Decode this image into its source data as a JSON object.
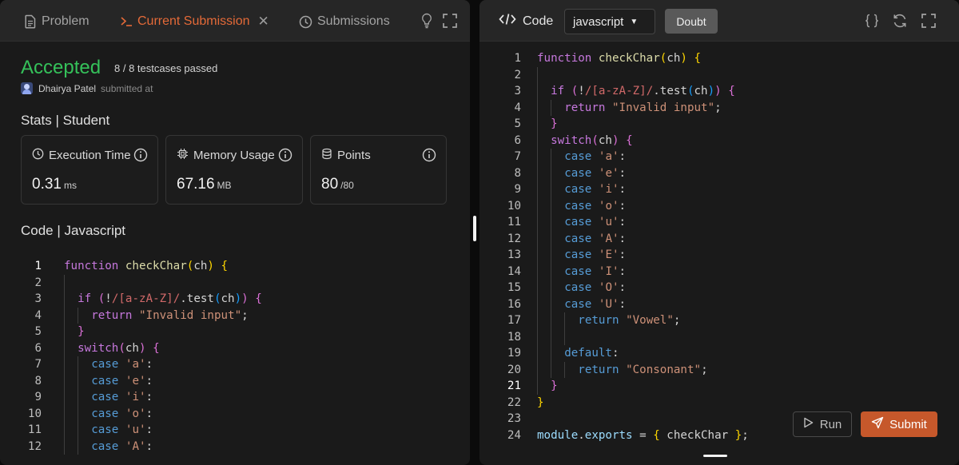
{
  "left_panel": {
    "tabs": [
      {
        "label": "Problem",
        "icon": "document-icon"
      },
      {
        "label": "Current Submission",
        "icon": "terminal-icon",
        "active": true
      },
      {
        "label": "Submissions",
        "icon": "clock-icon"
      }
    ],
    "status": "Accepted",
    "testcases": "8 / 8 testcases passed",
    "user_name": "Dhairya Patel",
    "submitted_label": "submitted at",
    "stats_title": "Stats | Student",
    "stats": [
      {
        "label": "Execution Time",
        "value": "0.31",
        "unit": "ms",
        "icon": "clock-icon"
      },
      {
        "label": "Memory Usage",
        "value": "67.16",
        "unit": "MB",
        "icon": "chip-icon"
      },
      {
        "label": "Points",
        "value": "80",
        "unit": "/80",
        "icon": "database-icon"
      }
    ],
    "code_title": "Code | Javascript",
    "code_line_count": 12
  },
  "right_panel": {
    "code_label": "Code",
    "language": "javascript",
    "doubt_label": "Doubt",
    "run_label": "Run",
    "submit_label": "Submit",
    "active_line": 21
  },
  "colors": {
    "accent": "#e46a38",
    "accepted": "#35c15a",
    "submit_bg": "#c6582b",
    "panel_bg": "#1a1a1a",
    "header_bg": "#262626"
  },
  "code_lines": [
    {
      "n": 1,
      "indent": 0,
      "tokens": [
        [
          "kw",
          "function"
        ],
        [
          "txt",
          " "
        ],
        [
          "fn",
          "checkChar"
        ],
        [
          "br1",
          "("
        ],
        [
          "txt",
          "ch"
        ],
        [
          "br1",
          ")"
        ],
        [
          "txt",
          " "
        ],
        [
          "br1",
          "{"
        ]
      ]
    },
    {
      "n": 2,
      "indent": 1,
      "tokens": []
    },
    {
      "n": 3,
      "indent": 1,
      "tokens": [
        [
          "kw",
          "if"
        ],
        [
          "txt",
          " "
        ],
        [
          "br2",
          "("
        ],
        [
          "txt",
          "!"
        ],
        [
          "re",
          "/[a-zA-Z]/"
        ],
        [
          "txt",
          ".test"
        ],
        [
          "br3",
          "("
        ],
        [
          "txt",
          "ch"
        ],
        [
          "br3",
          ")"
        ],
        [
          "br2",
          ")"
        ],
        [
          "txt",
          " "
        ],
        [
          "br2",
          "{"
        ]
      ]
    },
    {
      "n": 4,
      "indent": 2,
      "tokens": [
        [
          "kw",
          "return"
        ],
        [
          "txt",
          " "
        ],
        [
          "str",
          "\"Invalid input\""
        ],
        [
          "txt",
          ";"
        ]
      ]
    },
    {
      "n": 5,
      "indent": 1,
      "tokens": [
        [
          "br2",
          "}"
        ]
      ]
    },
    {
      "n": 6,
      "indent": 1,
      "tokens": [
        [
          "kw",
          "switch"
        ],
        [
          "br2",
          "("
        ],
        [
          "txt",
          "ch"
        ],
        [
          "br2",
          ")"
        ],
        [
          "txt",
          " "
        ],
        [
          "br2",
          "{"
        ]
      ]
    },
    {
      "n": 7,
      "indent": 2,
      "tokens": [
        [
          "blue",
          "case"
        ],
        [
          "txt",
          " "
        ],
        [
          "str",
          "'a'"
        ],
        [
          "txt",
          ":"
        ]
      ]
    },
    {
      "n": 8,
      "indent": 2,
      "tokens": [
        [
          "blue",
          "case"
        ],
        [
          "txt",
          " "
        ],
        [
          "str",
          "'e'"
        ],
        [
          "txt",
          ":"
        ]
      ]
    },
    {
      "n": 9,
      "indent": 2,
      "tokens": [
        [
          "blue",
          "case"
        ],
        [
          "txt",
          " "
        ],
        [
          "str",
          "'i'"
        ],
        [
          "txt",
          ":"
        ]
      ]
    },
    {
      "n": 10,
      "indent": 2,
      "tokens": [
        [
          "blue",
          "case"
        ],
        [
          "txt",
          " "
        ],
        [
          "str",
          "'o'"
        ],
        [
          "txt",
          ":"
        ]
      ]
    },
    {
      "n": 11,
      "indent": 2,
      "tokens": [
        [
          "blue",
          "case"
        ],
        [
          "txt",
          " "
        ],
        [
          "str",
          "'u'"
        ],
        [
          "txt",
          ":"
        ]
      ]
    },
    {
      "n": 12,
      "indent": 2,
      "tokens": [
        [
          "blue",
          "case"
        ],
        [
          "txt",
          " "
        ],
        [
          "str",
          "'A'"
        ],
        [
          "txt",
          ":"
        ]
      ]
    },
    {
      "n": 13,
      "indent": 2,
      "tokens": [
        [
          "blue",
          "case"
        ],
        [
          "txt",
          " "
        ],
        [
          "str",
          "'E'"
        ],
        [
          "txt",
          ":"
        ]
      ]
    },
    {
      "n": 14,
      "indent": 2,
      "tokens": [
        [
          "blue",
          "case"
        ],
        [
          "txt",
          " "
        ],
        [
          "str",
          "'I'"
        ],
        [
          "txt",
          ":"
        ]
      ]
    },
    {
      "n": 15,
      "indent": 2,
      "tokens": [
        [
          "blue",
          "case"
        ],
        [
          "txt",
          " "
        ],
        [
          "str",
          "'O'"
        ],
        [
          "txt",
          ":"
        ]
      ]
    },
    {
      "n": 16,
      "indent": 2,
      "tokens": [
        [
          "blue",
          "case"
        ],
        [
          "txt",
          " "
        ],
        [
          "str",
          "'U'"
        ],
        [
          "txt",
          ":"
        ]
      ]
    },
    {
      "n": 17,
      "indent": 3,
      "tokens": [
        [
          "blue",
          "return"
        ],
        [
          "txt",
          " "
        ],
        [
          "str",
          "\"Vowel\""
        ],
        [
          "txt",
          ";"
        ]
      ]
    },
    {
      "n": 18,
      "indent": 3,
      "tokens": []
    },
    {
      "n": 19,
      "indent": 2,
      "tokens": [
        [
          "blue",
          "default"
        ],
        [
          "txt",
          ":"
        ]
      ]
    },
    {
      "n": 20,
      "indent": 3,
      "tokens": [
        [
          "blue",
          "return"
        ],
        [
          "txt",
          " "
        ],
        [
          "str",
          "\"Consonant\""
        ],
        [
          "txt",
          ";"
        ]
      ]
    },
    {
      "n": 21,
      "indent": 1,
      "tokens": [
        [
          "br2",
          "}"
        ]
      ]
    },
    {
      "n": 22,
      "indent": 0,
      "tokens": [
        [
          "br1",
          "}"
        ]
      ]
    },
    {
      "n": 23,
      "indent": 0,
      "tokens": []
    },
    {
      "n": 24,
      "indent": 0,
      "tokens": [
        [
          "cyan",
          "module"
        ],
        [
          "txt",
          "."
        ],
        [
          "cyan",
          "exports"
        ],
        [
          "txt",
          " = "
        ],
        [
          "br1",
          "{"
        ],
        [
          "txt",
          " checkChar "
        ],
        [
          "br1",
          "}"
        ],
        [
          "txt",
          ";"
        ]
      ]
    }
  ]
}
